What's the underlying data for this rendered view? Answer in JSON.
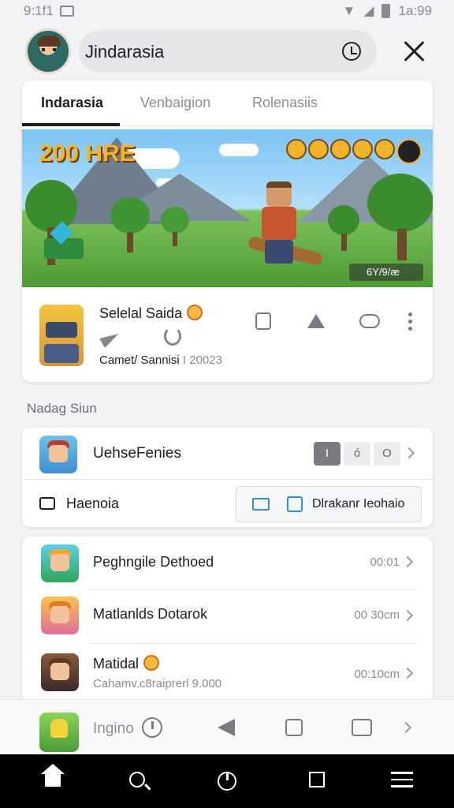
{
  "status_bar": {
    "time_left": "9:1f1",
    "time_right": "1a:99"
  },
  "search": {
    "query": "Jindarasia"
  },
  "tabs": [
    {
      "label": "Indarasia",
      "active": true
    },
    {
      "label": "Venbaigion",
      "active": false
    },
    {
      "label": "Rolenasiis",
      "active": false
    }
  ],
  "banner": {
    "badge_text": "200 HRE",
    "score_text": "6Y/9/æ"
  },
  "game": {
    "title": "Selelal Saida",
    "subtitle_author": "Camet/ Sannisi",
    "subtitle_year": "I 20023"
  },
  "section_label": "Nadag Siun",
  "mid_card": {
    "title": "UehseFenies",
    "chips": [
      "I",
      "ó",
      "O"
    ],
    "left_label": "Haenoia",
    "button_label": "Dlrakanr Ieohaio"
  },
  "list": [
    {
      "title": "Peghngile Dethoed",
      "time": "00:01",
      "subtitle": ""
    },
    {
      "title": "Matlanlds Dotarok",
      "time": "00 30cm",
      "subtitle": ""
    },
    {
      "title": "Matidal",
      "time": "00:10cm",
      "subtitle": "Cahamv.c8raiprerl 9.000"
    }
  ],
  "bottom_bar": {
    "label": "Ingino"
  },
  "colors": {
    "accent_blue": "#2f8fd8",
    "text_dark": "#1e1e22",
    "text_muted": "#8c8c94",
    "background": "#f3f3f5"
  }
}
